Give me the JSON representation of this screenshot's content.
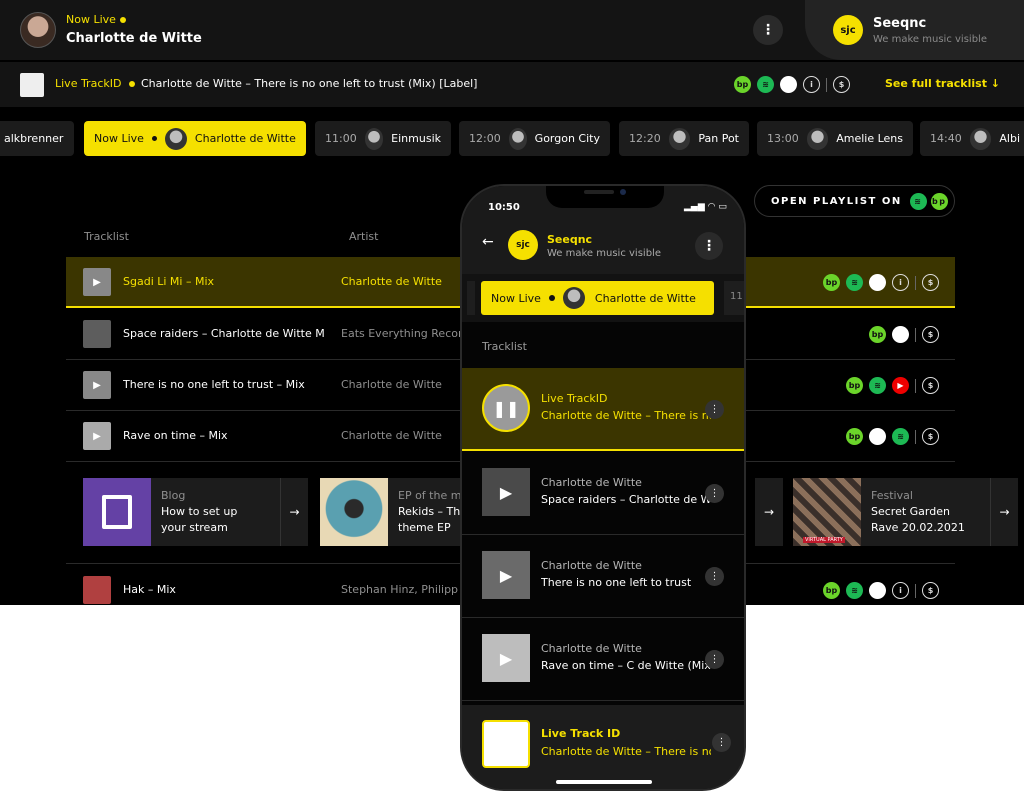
{
  "header": {
    "now_live_label": "Now Live",
    "artist_name": "Charlotte de Witte",
    "more_label": "⋮",
    "brand_logo_text": "sjc",
    "brand_name": "Seeqnc",
    "brand_tagline": "We make music visible"
  },
  "trackbar": {
    "label": "Live TrackID",
    "track": "Charlotte de Witte – There is no one left to trust (Mix) [Label]",
    "see_full": "See full tracklist ↓"
  },
  "chips": [
    {
      "time": "",
      "name": "alkbrenner"
    },
    {
      "time": "Now Live",
      "name": "Charlotte de Witte"
    },
    {
      "time": "11:00",
      "name": "Einmusik"
    },
    {
      "time": "12:00",
      "name": "Gorgon City"
    },
    {
      "time": "12:20",
      "name": "Pan Pot"
    },
    {
      "time": "13:00",
      "name": "Amelie Lens"
    },
    {
      "time": "14:40",
      "name": "Albi"
    }
  ],
  "open_playlist": {
    "label": "OPEN PLAYLIST ON"
  },
  "table": {
    "col_tracklist": "Tracklist",
    "col_artist": "Artist",
    "rows": [
      {
        "title": "Sgadi Li Mi – Mix",
        "artist": "Charlotte de Witte"
      },
      {
        "title": "Space raiders – Charlotte de Witte M",
        "artist": "Eats Everything Recor"
      },
      {
        "title": "There is no one left to trust – Mix",
        "artist": "Charlotte de Witte"
      },
      {
        "title": "Rave on time – Mix",
        "artist": "Charlotte de Witte"
      },
      {
        "title": "Hak – Mix",
        "artist": "Stephan Hinz, Philipp"
      }
    ]
  },
  "cards": [
    {
      "category": "Blog",
      "line1": "How to set up",
      "line2": "your stream",
      "arrow": "→"
    },
    {
      "category": "EP of the m",
      "line1": "Rekids – Th",
      "line2": "theme EP",
      "arrow": "→"
    },
    {
      "category": "Festival",
      "line1": "Secret Garden",
      "line2": "Rave 20.02.2021",
      "arrow": "→"
    }
  ],
  "card_extra_arrow": "→",
  "card_virtual_label": "VIRTUAL PARTY",
  "phone": {
    "time": "10:50",
    "status_icons": "▂▄▆ ◠ ▭",
    "back": "←",
    "logo_text": "sjc",
    "brand_name": "Seeqnc",
    "brand_tagline": "We make music visible",
    "chip_now_live": "Now Live",
    "chip_artist": "Charlotte de Witte",
    "chip_next": "11",
    "section_title": "Tracklist",
    "rows": [
      {
        "line1": "Live TrackID",
        "line2": "Charlotte de Witte – There is no"
      },
      {
        "line1": "Charlotte de Witte",
        "line2": "Space raiders – Charlotte de W"
      },
      {
        "line1": "Charlotte de Witte",
        "line2": "There is no one left to trust"
      },
      {
        "line1": "Charlotte de Witte",
        "line2": "Rave on time – C de Witte (Mix"
      }
    ],
    "bottom": {
      "line1": "Live Track ID",
      "line2": "Charlotte de Witte – There is no"
    },
    "row_more": "⋮"
  },
  "icons": {
    "beatport": "bp",
    "spotify": "≋",
    "apple": "",
    "info": "i",
    "dollar": "$",
    "youtube": "▶",
    "play": "▶",
    "pause": "❚❚"
  },
  "colors": {
    "accent": "#f5e000",
    "bg": "#000000",
    "panel": "#141414"
  }
}
